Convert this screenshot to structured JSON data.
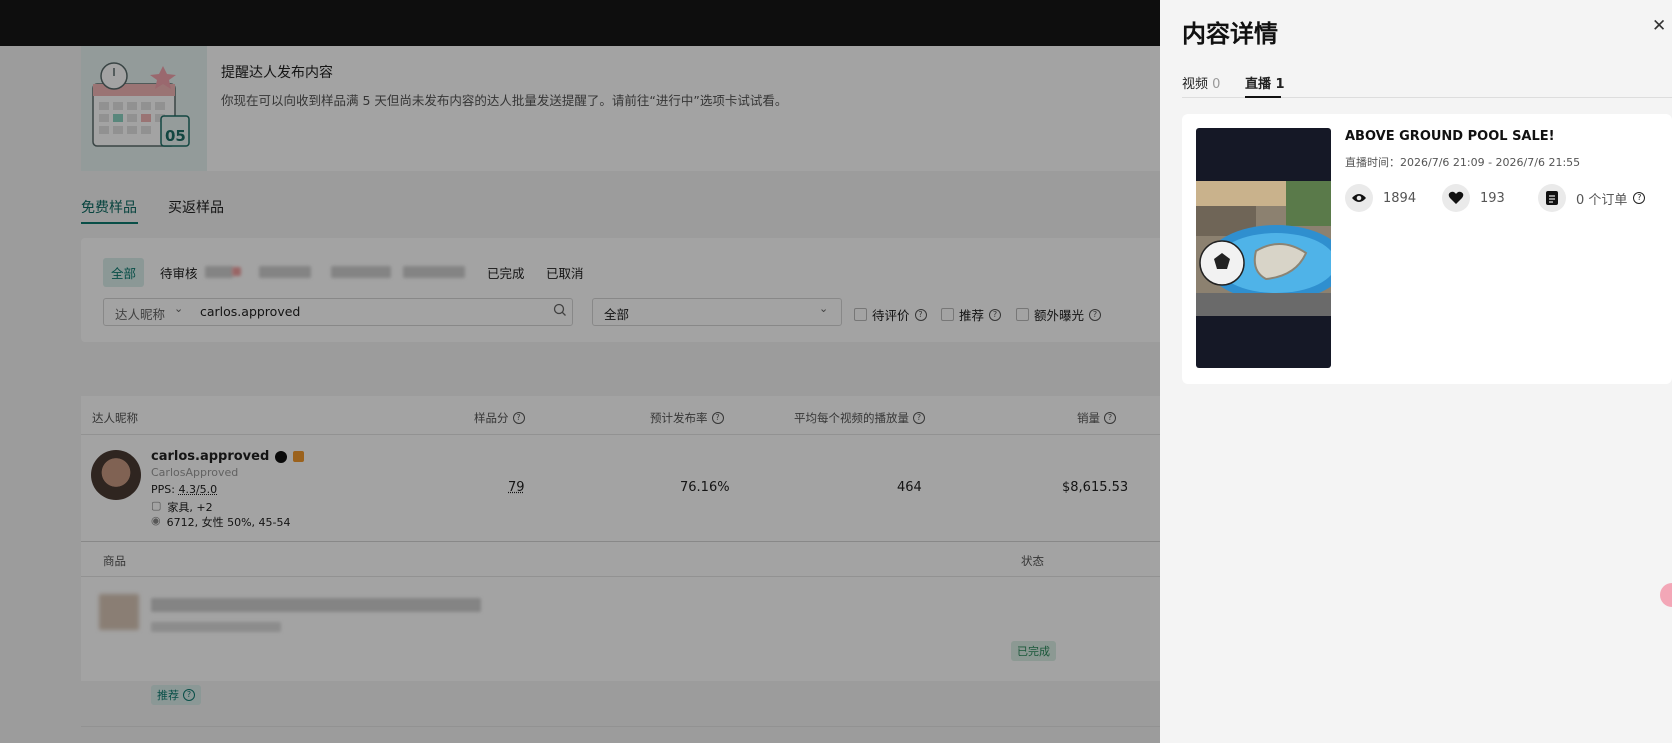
{
  "banner": {
    "title": "提醒达人发布内容",
    "desc": "你现在可以向收到样品满 5 天但尚未发布内容的达人批量发送提醒了。请前往“进行中”选项卡试试看。",
    "badge_number": "05"
  },
  "main_tabs": [
    {
      "label": "免费样品",
      "active": true
    },
    {
      "label": "买返样品",
      "active": false
    }
  ],
  "status_tabs": [
    {
      "label": "全部",
      "active": true
    },
    {
      "label": "待审核"
    },
    {
      "label": "已完成"
    },
    {
      "label": "已取消"
    }
  ],
  "search": {
    "field_select": "达人昵称",
    "value": "carlos.approved",
    "status_select": "全部"
  },
  "filters": {
    "pending_review": "待评价",
    "recommended": "推荐",
    "extra_exposure": "额外曝光"
  },
  "table": {
    "headers": {
      "creator": "达人昵称",
      "sample_score": "样品分",
      "post_rate": "预计发布率",
      "avg_views": "平均每个视频的播放量",
      "sales": "销量"
    },
    "row": {
      "name": "carlos.approved",
      "handle": "CarlosApproved",
      "pps_label": "PPS:",
      "pps_value": "4.3/5.0",
      "category": "家具, +2",
      "audience": "6712, 女性 50%, 45-54",
      "sample_score": "79",
      "post_rate": "76.16%",
      "avg_views": "464",
      "sales": "$8,615.53"
    },
    "sub_headers": {
      "product": "商品",
      "status": "状态"
    },
    "product_row": {
      "status": "已完成",
      "badge": "推荐"
    }
  },
  "drawer": {
    "title": "内容详情",
    "tabs": [
      {
        "label": "视频",
        "count": "0",
        "active": false
      },
      {
        "label": "直播",
        "count": "1",
        "active": true
      }
    ],
    "live": {
      "title": "ABOVE GROUND POOL SALE!",
      "time": "直播时间：2026/7/6 21:09 - 2026/7/6 21:55",
      "views": "1894",
      "likes": "193",
      "orders": "0 个订单"
    }
  },
  "colors": {
    "accent": "#0d7a70",
    "topbar": "#161616"
  }
}
